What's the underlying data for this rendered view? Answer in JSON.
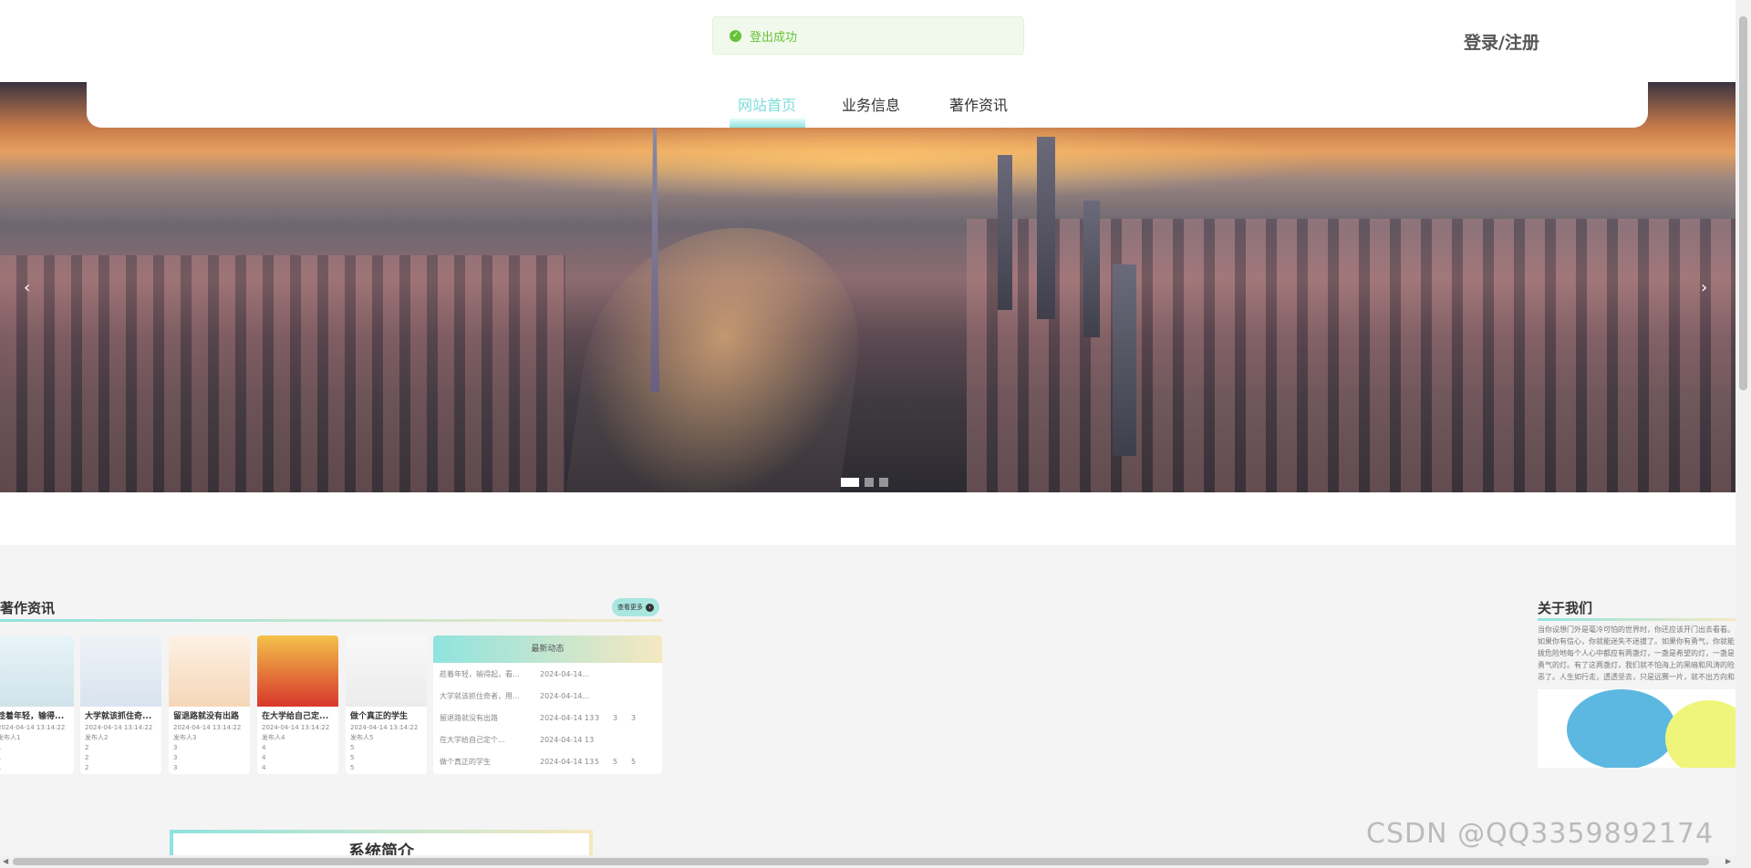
{
  "header": {
    "login_register": "登录/注册"
  },
  "toast": {
    "message": "登出成功",
    "icon": "check-circle-icon"
  },
  "nav": {
    "items": [
      "网站首页",
      "业务信息",
      "著作资讯"
    ],
    "active_index": 0,
    "accent_color": "#7ddcd8"
  },
  "banner": {
    "prev_arrow": "‹",
    "next_arrow": "›",
    "slide_count": 3,
    "active_slide": 0
  },
  "news": {
    "title": "著作资讯",
    "more_label": "查看更多",
    "cards": [
      {
        "title": "趁着年轻，输得...",
        "date": "2024-04-14 13:14:22",
        "author": "发布人1",
        "c1": "1",
        "c2": "1",
        "c3": "1"
      },
      {
        "title": "大学就该抓住奇...",
        "date": "2024-04-14 13:14:22",
        "author": "发布人2",
        "c1": "2",
        "c2": "2",
        "c3": "2"
      },
      {
        "title": "留退路就没有出路",
        "date": "2024-04-14 13:14:22",
        "author": "发布人3",
        "c1": "3",
        "c2": "3",
        "c3": "3"
      },
      {
        "title": "在大学给自己定...",
        "date": "2024-04-14 13:14:22",
        "author": "发布人4",
        "c1": "4",
        "c2": "4",
        "c3": "4"
      },
      {
        "title": "做个真正的学生",
        "date": "2024-04-14 13:14:22",
        "author": "发布人5",
        "c1": "5",
        "c2": "5",
        "c3": "5"
      }
    ],
    "latest": {
      "title": "最新动态",
      "rows": [
        {
          "title": "趁着年轻，输得起，看...",
          "date": "2024-04-14...",
          "a": "",
          "b": "",
          "c": ""
        },
        {
          "title": "大学就该抓住奇者，用...",
          "date": "2024-04-14...",
          "a": "",
          "b": "",
          "c": ""
        },
        {
          "title": "留退路就没有出路",
          "date": "2024-04-14 13:14:22",
          "a": "3",
          "b": "3",
          "c": "3"
        },
        {
          "title": "在大学给自己定个...",
          "date": "2024-04-14 13:1...",
          "a": "",
          "b": "",
          "c": ""
        },
        {
          "title": "做个真正的学生",
          "date": "2024-04-14 13:14:22",
          "a": "5",
          "b": "5",
          "c": "5"
        }
      ]
    }
  },
  "about": {
    "title": "关于我们",
    "text": "当你设想门外是毫冷可怕的世界时，你还应该开门出去看看。如果你有信心，你就能迷失不迷拔了。如果你有勇气，你就能拨危险地每个人心中都应有两盏灯，一盏是希望的灯，一盏是勇气的灯。有了这两盏灯，我们就不怕海上的黑暗和风涛的险恶了。人生如行走，透透坚去，只是远赛一片，就不出方向和去远。"
  },
  "intro": {
    "title": "系统简介"
  },
  "watermark": "CSDN @QQ3359892174"
}
